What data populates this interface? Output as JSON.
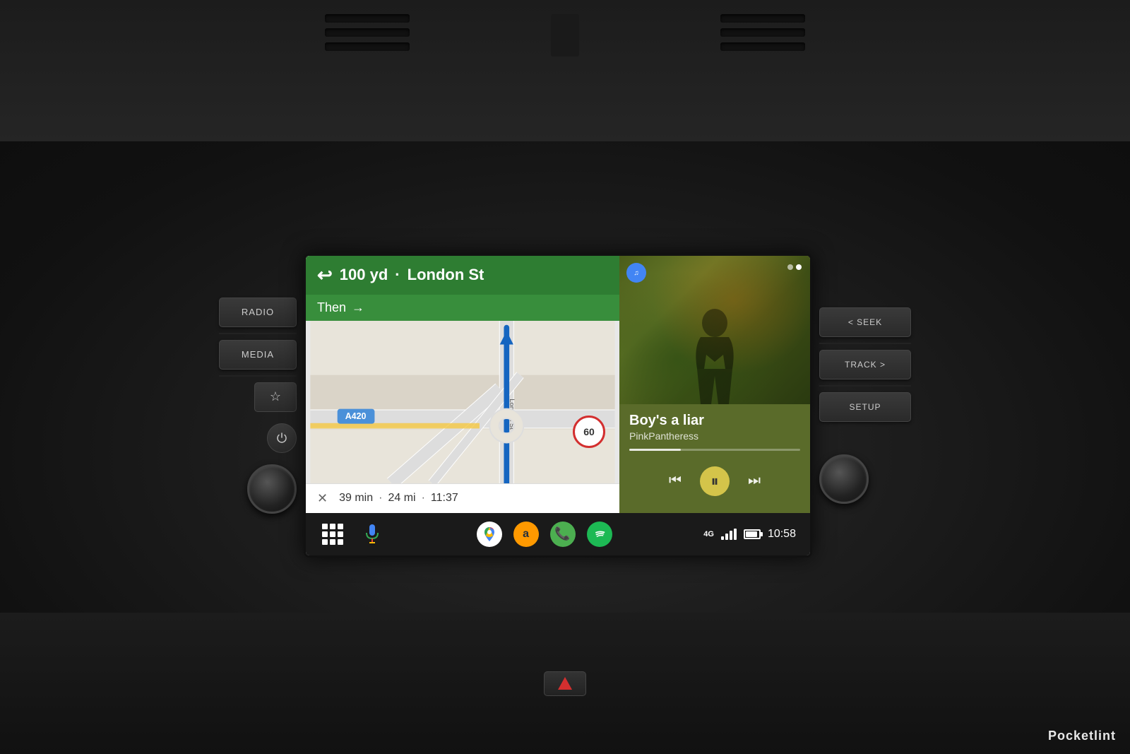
{
  "dashboard": {
    "background_color": "#1a1a1a"
  },
  "navigation": {
    "instruction_distance": "100 yd",
    "instruction_street": "London St",
    "instruction_icon": "←",
    "sub_instruction": "Then",
    "sub_instruction_icon": "→",
    "eta_minutes": "39 min",
    "eta_distance": "24 mi",
    "eta_time": "11:37",
    "speed_limit": "60",
    "street_label": "London St"
  },
  "music": {
    "title": "Boy's a liar",
    "artist": "PinkPantheress",
    "service_icon": "♫",
    "progress_percent": 30
  },
  "taskbar": {
    "apps": [
      {
        "name": "Google Maps",
        "icon": "🗺"
      },
      {
        "name": "Amazon Music",
        "icon": "a"
      },
      {
        "name": "Phone",
        "icon": "📞"
      },
      {
        "name": "Spotify",
        "icon": "♫"
      }
    ],
    "signal": "4G",
    "time": "10:58"
  },
  "controls": {
    "left": [
      {
        "label": "RADIO"
      },
      {
        "label": "MEDIA"
      },
      {
        "label": "☆"
      }
    ],
    "right": [
      {
        "label": "< SEEK"
      },
      {
        "label": "TRACK >"
      },
      {
        "label": "SETUP"
      }
    ]
  },
  "watermark": {
    "brand": "Pocket",
    "brand_bold": "lint"
  }
}
